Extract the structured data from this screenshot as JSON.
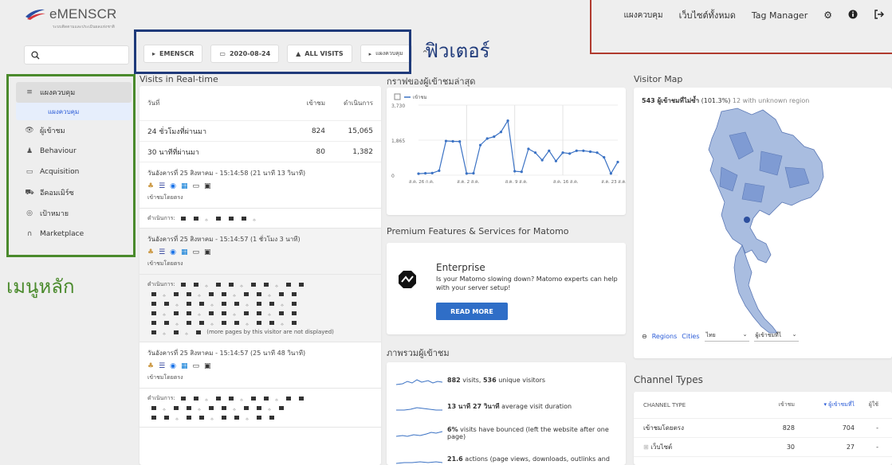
{
  "header": {
    "logo_text": "eMENSCR",
    "logo_sub": "ระบบติดตามและประเมินผลแห่งชาติ",
    "nav": [
      "แผงควบคุม",
      "เว็บไซต์ทั้งหมด",
      "Tag Manager"
    ],
    "icons": [
      "gear-icon",
      "info-icon",
      "logout-icon"
    ]
  },
  "search": {
    "placeholder": ""
  },
  "filters": {
    "site": "EMENSCR",
    "date": "2020-08-24",
    "segment": "ALL VISITS",
    "dashboard": "แผงควบคุม",
    "annotation": "ฟิวเตอร์"
  },
  "sidebar": {
    "items": [
      {
        "label": "แผงควบคุม",
        "icon": "dashboard-icon"
      },
      {
        "label": "ผู้เข้าชม",
        "icon": "visitors-icon"
      },
      {
        "label": "Behaviour",
        "icon": "behaviour-icon"
      },
      {
        "label": "Acquisition",
        "icon": "acquisition-icon"
      },
      {
        "label": "อีคอมเมิร์ซ",
        "icon": "ecommerce-icon"
      },
      {
        "label": "เป้าหมาย",
        "icon": "goals-icon"
      },
      {
        "label": "Marketplace",
        "icon": "marketplace-icon"
      }
    ],
    "sub_item": "แผงควบคุม",
    "annotation": "เมนูหลัก"
  },
  "realtime": {
    "title": "Visits in Real-time",
    "headers": [
      "วันที่",
      "เข้าชม",
      "ดำเนินการ"
    ],
    "rows": [
      {
        "label": "24 ชั่วโมงที่ผ่านมา",
        "visits": "824",
        "actions": "15,065"
      },
      {
        "label": "30 นาทีที่ผ่านมา",
        "visits": "80",
        "actions": "1,382"
      }
    ],
    "visits": [
      {
        "time": "วันอังคารที่ 25 สิงหาคม - 15:14:58 (21 นาที 13 วินาที)",
        "source": "เข้าชมโดยตรง",
        "actions_label": "ดำเนินการ:"
      },
      {
        "time": "วันอังคารที่ 25 สิงหาคม - 15:14:57 (1 ชั่วโมง 3 นาที)",
        "source": "เข้าชมโดยตรง",
        "actions_label": "ดำเนินการ:",
        "more": "(more pages by this visitor are not displayed)"
      },
      {
        "time": "วันอังคารที่ 25 สิงหาคม - 15:14:57 (25 นาที 48 วินาที)",
        "source": "เข้าชมโดยตรง",
        "actions_label": "ดำเนินการ:"
      }
    ]
  },
  "graph": {
    "title": "กราฟของผู้เข้าชมล่าสุด",
    "legend": "เข้าชม",
    "accent": "#3b72c4"
  },
  "premium": {
    "title": "Premium Features & Services for Matomo",
    "heading": "Enterprise",
    "text": "Is your Matomo slowing down? Matomo experts can help with your server setup!",
    "button": "READ MORE"
  },
  "overview": {
    "title": "ภาพรวมผู้เข้าชม",
    "rows": [
      {
        "bold": "882",
        "text": " visits, ",
        "bold2": "536",
        "text2": " unique visitors"
      },
      {
        "bold": "13 นาที 27 วินาที",
        "text": " average visit duration",
        "bold2": "",
        "text2": ""
      },
      {
        "bold": "6%",
        "text": " visits have bounced (left the website after one page)",
        "bold2": "",
        "text2": ""
      },
      {
        "bold": "21.6",
        "text": " actions (page views, downloads, outlinks and",
        "bold2": "",
        "text2": ""
      }
    ]
  },
  "map": {
    "title": "Visitor Map",
    "summary_bold": "543 ผู้เข้าชมที่ไม่ซ้ำ",
    "summary": " (101.3%)",
    "summary_small": " 12 with unknown region",
    "regions": "Regions",
    "cities": "Cities",
    "country": "ไทย",
    "metric": "ผู้เข้าชมที่ไ",
    "fill": "#a9bde0"
  },
  "channel": {
    "title": "Channel Types",
    "headers": [
      "CHANNEL TYPE",
      "เข้าชม",
      "ผู้เข้าชมที่ไ",
      "ผู้ใช้"
    ],
    "rows": [
      {
        "type": "เข้าชมโดยตรง",
        "visits": "828",
        "unique": "704",
        "users": "-"
      },
      {
        "type": "เว็บไซต์",
        "visits": "30",
        "unique": "27",
        "users": "-"
      }
    ]
  },
  "chart_data": {
    "type": "line",
    "series": [
      {
        "name": "เข้าชม",
        "values": [
          80,
          100,
          110,
          240,
          1820,
          1800,
          1790,
          90,
          100,
          1600,
          1950,
          2050,
          2300,
          2900,
          210,
          180,
          1400,
          1200,
          800,
          1300,
          750,
          1200,
          1150,
          1300,
          1300,
          1250,
          1200,
          950,
          90,
          700
        ]
      }
    ],
    "x": [
      "ส.ค. 26 ก.ค.",
      "",
      "",
      "",
      "",
      "",
      "",
      "ส.ค. 2 ส.ค.",
      "",
      "",
      "",
      "",
      "",
      "",
      "ส.ค. 9 ส.ค.",
      "",
      "",
      "",
      "",
      "",
      "",
      "ส.ค. 16 ส.ค.",
      "",
      "",
      "",
      "",
      "",
      "",
      "ส.ค. 23 ส.ค.",
      ""
    ],
    "yticks": [
      "3,730",
      "1,865",
      "0"
    ],
    "ylim": [
      0,
      3730
    ],
    "legend_position": "top-left"
  }
}
